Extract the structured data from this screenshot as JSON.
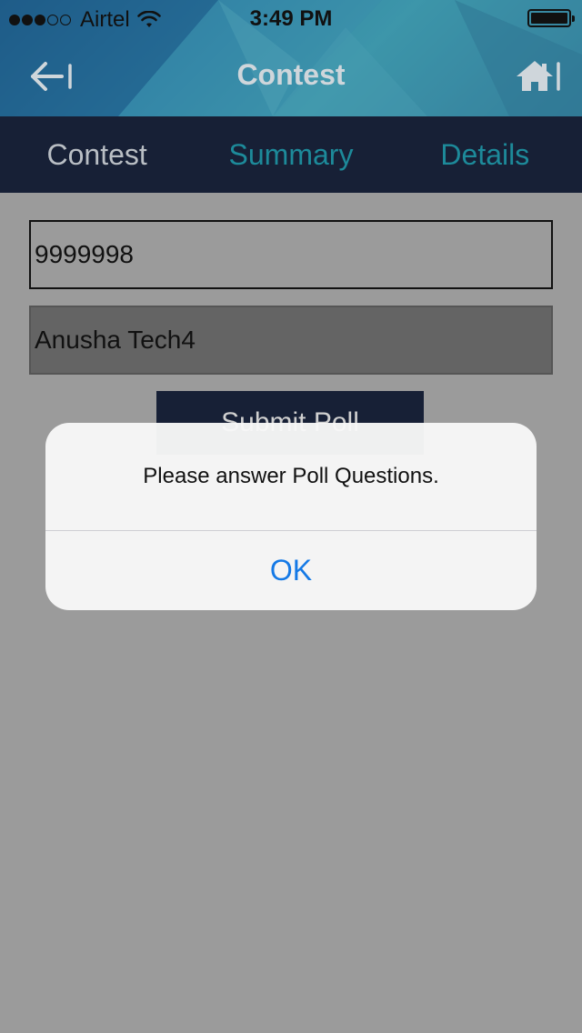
{
  "status_bar": {
    "carrier": "Airtel",
    "time": "3:49 PM",
    "signal_bars_full": 3,
    "signal_bars_total": 5
  },
  "nav": {
    "title": "Contest",
    "back_icon": "back-arrow-icon",
    "home_icon": "home-icon"
  },
  "tabs": [
    {
      "label": "Contest",
      "active": true
    },
    {
      "label": "Summary",
      "active": false
    },
    {
      "label": "Details",
      "active": false
    }
  ],
  "form": {
    "id_value": "9999998",
    "name_value": "Anusha Tech4",
    "submit_label": "Submit Poll"
  },
  "alert": {
    "message": "Please answer Poll Questions.",
    "ok_label": "OK"
  },
  "colors": {
    "tab_bar": "#172036",
    "active_tab": "#b9bec4",
    "inactive_tab": "#1d8a9a",
    "alert_button": "#1479e6",
    "background": "#9b9b9b"
  }
}
